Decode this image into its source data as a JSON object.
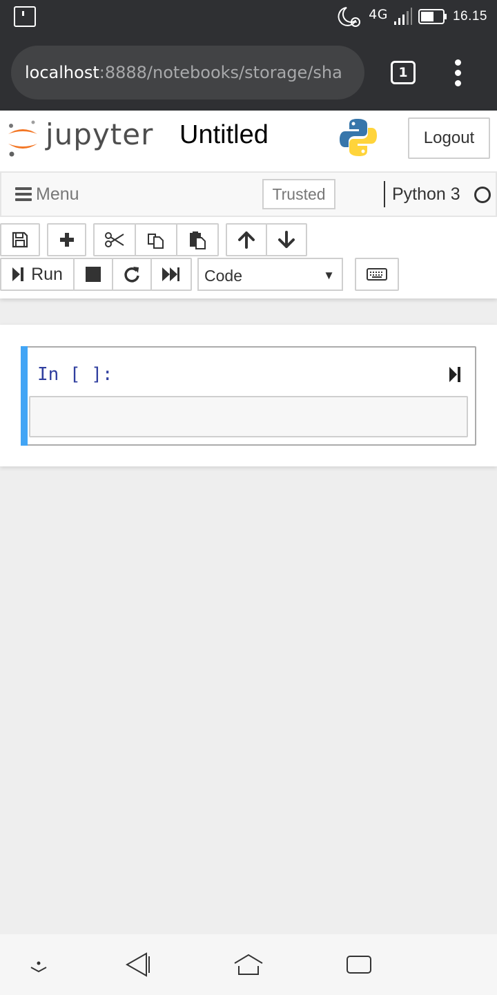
{
  "status_bar": {
    "network": "4G",
    "time": "16.15",
    "battery_level": 0.6,
    "icons": [
      "notification-icon",
      "do-not-disturb-moon-icon",
      "alarm-icon",
      "signal-icon",
      "battery-icon"
    ]
  },
  "browser": {
    "url_host": "localhost",
    "url_path": ":8888/notebooks/storage/sha",
    "tab_count": "1",
    "icons": [
      "tab-switcher-icon",
      "overflow-menu-icon"
    ]
  },
  "jupyter": {
    "logo_text": "jupyter",
    "notebook_title": "Untitled",
    "logout_label": "Logout",
    "menu_label": "Menu",
    "trusted_label": "Trusted",
    "kernel_name": "Python 3",
    "kernel_status": "idle"
  },
  "toolbar": {
    "run_label": "Run",
    "cell_type": "Code",
    "cell_type_options": [
      "Code"
    ],
    "icons": [
      "save-icon",
      "insert-cell-icon",
      "cut-icon",
      "copy-icon",
      "paste-icon",
      "move-up-icon",
      "move-down-icon",
      "run-icon",
      "interrupt-icon",
      "restart-icon",
      "run-all-icon",
      "keyboard-icon"
    ]
  },
  "cell": {
    "prompt": "In [ ]:",
    "source": ""
  },
  "colors": {
    "status_bar_bg": "#2f3033",
    "cell_selected_bar": "#42a5f5",
    "prompt_color": "#303f9f",
    "jupyter_orange": "#f37726"
  }
}
